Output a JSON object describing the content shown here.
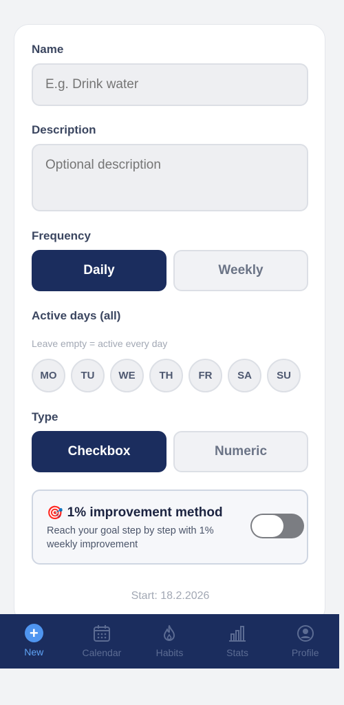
{
  "form": {
    "name_label": "Name",
    "name_placeholder": "E.g. Drink water",
    "description_label": "Description",
    "description_placeholder": "Optional description",
    "frequency_label": "Frequency",
    "frequency_options": [
      "Daily",
      "Weekly"
    ],
    "frequency_selected": "Daily",
    "active_days_label": "Active days (all)",
    "active_days_hint": "Leave empty = active every day",
    "days": [
      "MO",
      "TU",
      "WE",
      "TH",
      "FR",
      "SA",
      "SU"
    ],
    "type_label": "Type",
    "type_options": [
      "Checkbox",
      "Numeric"
    ],
    "type_selected": "Checkbox",
    "improvement_emoji": "🎯",
    "improvement_title": "1% improvement method",
    "improvement_desc": "Reach your goal step by step with 1% weekly improvement",
    "improvement_enabled": false,
    "start_text": "Start: 18.2.2026"
  },
  "nav": {
    "items": [
      {
        "label": "New",
        "icon": "plus-circle-icon",
        "active": true
      },
      {
        "label": "Calendar",
        "icon": "calendar-icon",
        "active": false
      },
      {
        "label": "Habits",
        "icon": "flame-icon",
        "active": false
      },
      {
        "label": "Stats",
        "icon": "bar-chart-icon",
        "active": false
      },
      {
        "label": "Profile",
        "icon": "user-icon",
        "active": false
      }
    ]
  },
  "colors": {
    "primary": "#1b2d5e",
    "accent": "#4f95f0",
    "toggle_off": "#7b7d82"
  }
}
